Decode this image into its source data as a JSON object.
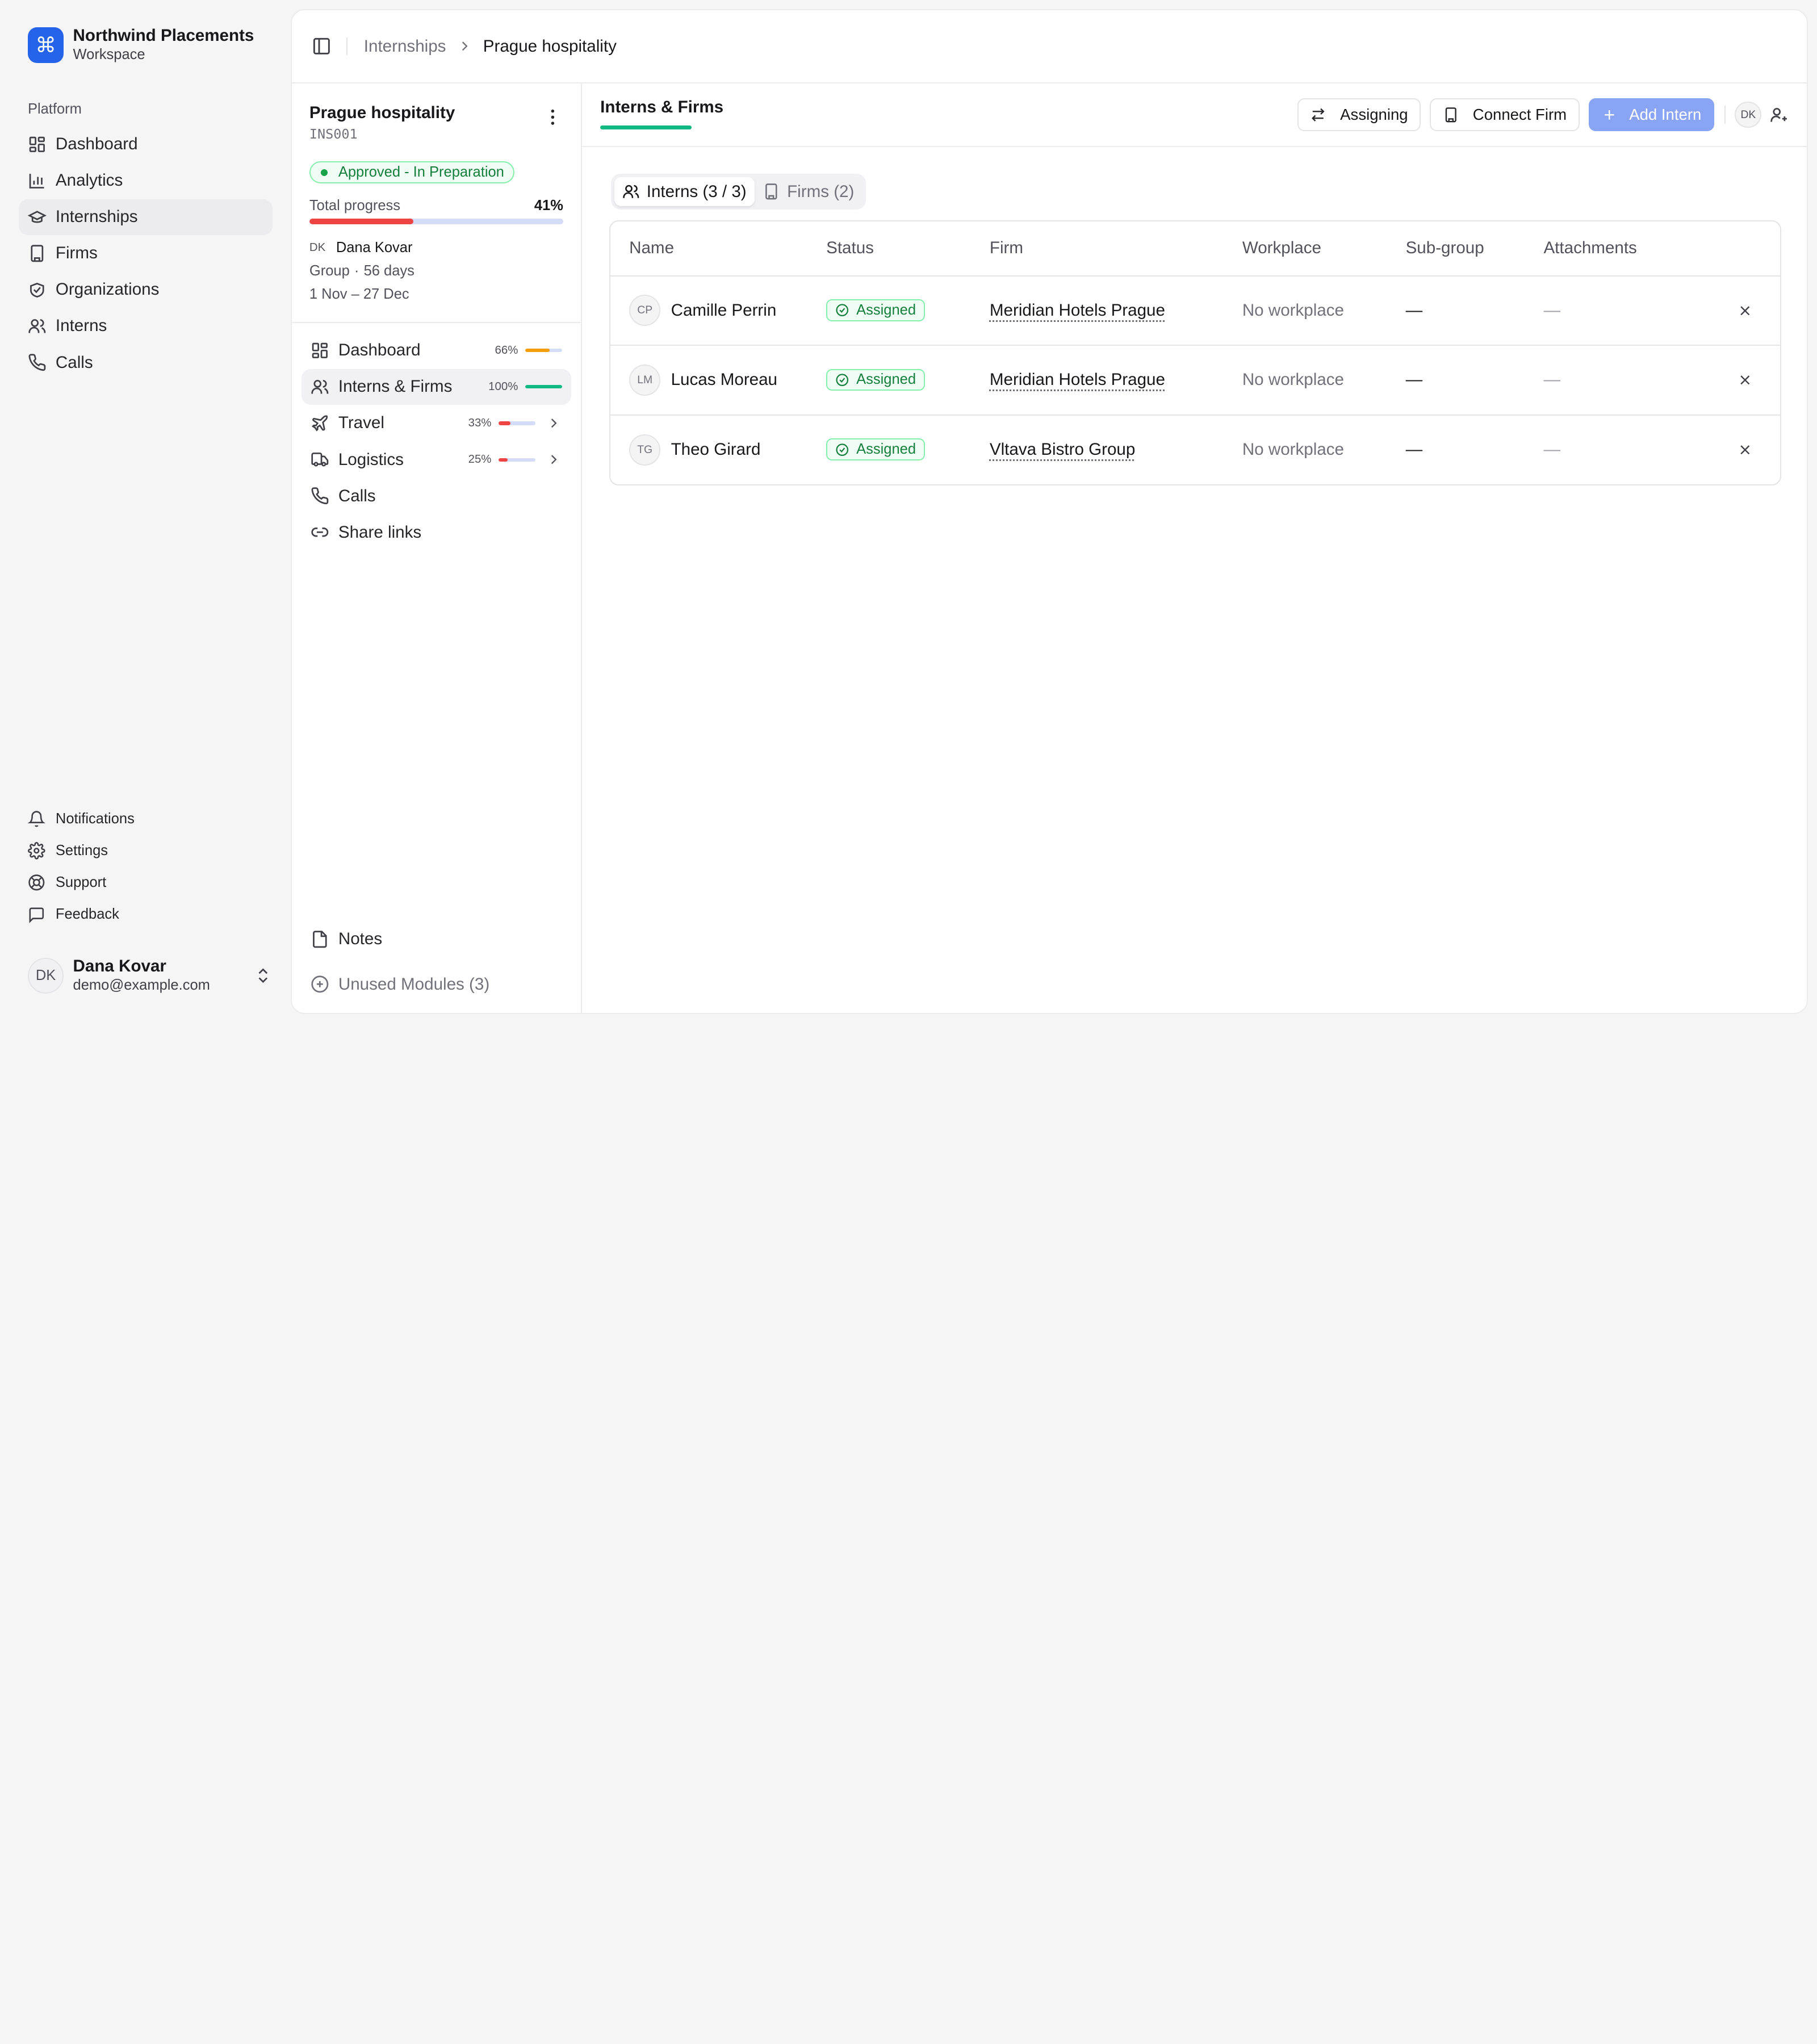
{
  "brand": {
    "title": "Northwind Placements",
    "subtitle": "Workspace",
    "logo_glyph": "⌘",
    "color": "#2563eb"
  },
  "sidebar": {
    "section_label": "Platform",
    "items": [
      {
        "label": "Dashboard",
        "icon": "dashboard-icon"
      },
      {
        "label": "Analytics",
        "icon": "bar-chart-icon"
      },
      {
        "label": "Internships",
        "icon": "graduation-cap-icon",
        "active": true
      },
      {
        "label": "Firms",
        "icon": "building-icon"
      },
      {
        "label": "Organizations",
        "icon": "handshake-icon"
      },
      {
        "label": "Interns",
        "icon": "users-icon"
      },
      {
        "label": "Calls",
        "icon": "phone-icon"
      }
    ],
    "bottom_items": [
      {
        "label": "Notifications",
        "icon": "bell-icon"
      },
      {
        "label": "Settings",
        "icon": "gear-icon"
      },
      {
        "label": "Support",
        "icon": "lifebuoy-icon"
      },
      {
        "label": "Feedback",
        "icon": "message-square-icon"
      }
    ],
    "user": {
      "initials": "DK",
      "name": "Dana Kovar",
      "email": "demo@example.com"
    }
  },
  "breadcrumb": {
    "parent": "Internships",
    "current": "Prague hospitality"
  },
  "internship": {
    "title": "Prague hospitality",
    "code": "INS001",
    "status": "Approved - In Preparation",
    "progress_label": "Total progress",
    "progress_pct": "41%",
    "progress_value": 41,
    "owner_initials": "DK",
    "owner_name": "Dana Kovar",
    "type": "Group",
    "duration": "56 days",
    "dates": "1 Nov – 27 Dec"
  },
  "modules": [
    {
      "label": "Dashboard",
      "pct": "66%",
      "value": 66,
      "color": "#f59e0b",
      "icon": "dashboard-icon"
    },
    {
      "label": "Interns & Firms",
      "pct": "100%",
      "value": 100,
      "color": "#10b981",
      "icon": "users-icon",
      "active": true
    },
    {
      "label": "Travel",
      "pct": "33%",
      "value": 33,
      "color": "#ef4444",
      "icon": "plane-icon",
      "chevron": true
    },
    {
      "label": "Logistics",
      "pct": "25%",
      "value": 25,
      "color": "#ef4444",
      "icon": "truck-icon",
      "chevron": true
    },
    {
      "label": "Calls",
      "icon": "phone-icon"
    },
    {
      "label": "Share links",
      "icon": "link-icon"
    }
  ],
  "notes_label": "Notes",
  "unused_label": "Unused Modules (3)",
  "panel": {
    "title": "Interns & Firms",
    "assigning_label": "Assigning",
    "connect_label": "Connect Firm",
    "add_label": "Add Intern",
    "avatar_initials": "DK"
  },
  "tabs": [
    {
      "label": "Interns (3 / 3)",
      "active": true
    },
    {
      "label": "Firms (2)"
    }
  ],
  "table": {
    "headers": [
      "Name",
      "Status",
      "Firm",
      "Workplace",
      "Sub-group",
      "Attachments"
    ],
    "rows": [
      {
        "initials": "CP",
        "name": "Camille Perrin",
        "status": "Assigned",
        "firm": "Meridian Hotels Prague",
        "workplace": "No workplace",
        "subgroup": "—",
        "attachments": "—"
      },
      {
        "initials": "LM",
        "name": "Lucas Moreau",
        "status": "Assigned",
        "firm": "Meridian Hotels Prague",
        "workplace": "No workplace",
        "subgroup": "—",
        "attachments": "—"
      },
      {
        "initials": "TG",
        "name": "Theo Girard",
        "status": "Assigned",
        "firm": "Vltava Bistro Group",
        "workplace": "No workplace",
        "subgroup": "—",
        "attachments": "—"
      }
    ]
  },
  "colors": {
    "accent_green": "#10b981",
    "progress_red": "#ef4444",
    "primary_button": "#8aa4f5"
  }
}
